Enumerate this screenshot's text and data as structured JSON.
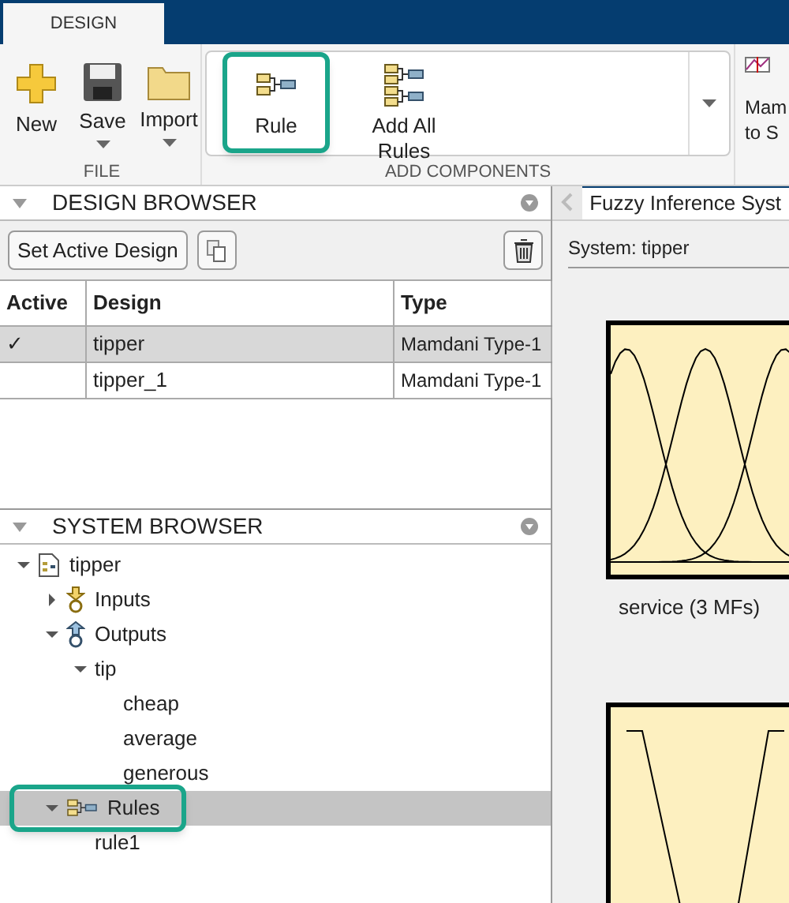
{
  "tabs": [
    {
      "label": "DESIGN",
      "selected": true
    }
  ],
  "ribbon": {
    "groups": [
      {
        "title": "FILE",
        "buttons": [
          {
            "label": "New",
            "kind": "new",
            "menu": false,
            "highlighted": false
          },
          {
            "label": "Save",
            "kind": "save",
            "menu": true,
            "highlighted": false
          },
          {
            "label": "Import",
            "kind": "import",
            "menu": true,
            "highlighted": false
          }
        ]
      },
      {
        "title": "ADD COMPONENTS",
        "buttons": [
          {
            "label": "Rule",
            "kind": "rule",
            "menu": false,
            "highlighted": true
          },
          {
            "label": "Add All Rules",
            "kind": "rules",
            "menu": false,
            "highlighted": false
          }
        ]
      }
    ],
    "partial_button": {
      "lines": [
        "Mam",
        "to S"
      ]
    }
  },
  "design_browser": {
    "title": "DESIGN BROWSER",
    "set_active_button": "Set Active Design",
    "table": {
      "columns": [
        "Active",
        "Design",
        "Type"
      ],
      "rows": [
        {
          "active_mark": "✓",
          "design": "tipper",
          "type": "Mamdani Type-1",
          "selected": true
        },
        {
          "active_mark": "",
          "design": "tipper_1",
          "type": "Mamdani Type-1",
          "selected": false
        }
      ]
    }
  },
  "system_browser": {
    "title": "SYSTEM BROWSER",
    "tree": [
      {
        "label": "tipper",
        "kind": "system",
        "expanded": true,
        "selected": false,
        "highlighted": false,
        "children": [
          {
            "label": "Inputs",
            "kind": "inputs",
            "expanded": false,
            "selected": false,
            "highlighted": false
          },
          {
            "label": "Outputs",
            "kind": "outputs",
            "expanded": true,
            "selected": false,
            "highlighted": false,
            "children": [
              {
                "label": "tip",
                "expanded": true,
                "selected": false,
                "highlighted": false,
                "children": [
                  {
                    "label": "cheap",
                    "selected": false,
                    "highlighted": false
                  },
                  {
                    "label": "average",
                    "selected": false,
                    "highlighted": false
                  },
                  {
                    "label": "generous",
                    "selected": false,
                    "highlighted": false
                  }
                ]
              }
            ]
          },
          {
            "label": "Rules",
            "kind": "rules",
            "expanded": true,
            "selected": true,
            "highlighted": true,
            "children": [
              {
                "label": "rule1",
                "selected": false,
                "highlighted": false
              }
            ]
          }
        ]
      }
    ]
  },
  "document": {
    "tab": "Fuzzy Inference Syst",
    "system_label": "System: tipper",
    "plots": [
      {
        "kind": "gauss",
        "label": "service (3 MFs)"
      },
      {
        "kind": "trap"
      }
    ]
  }
}
